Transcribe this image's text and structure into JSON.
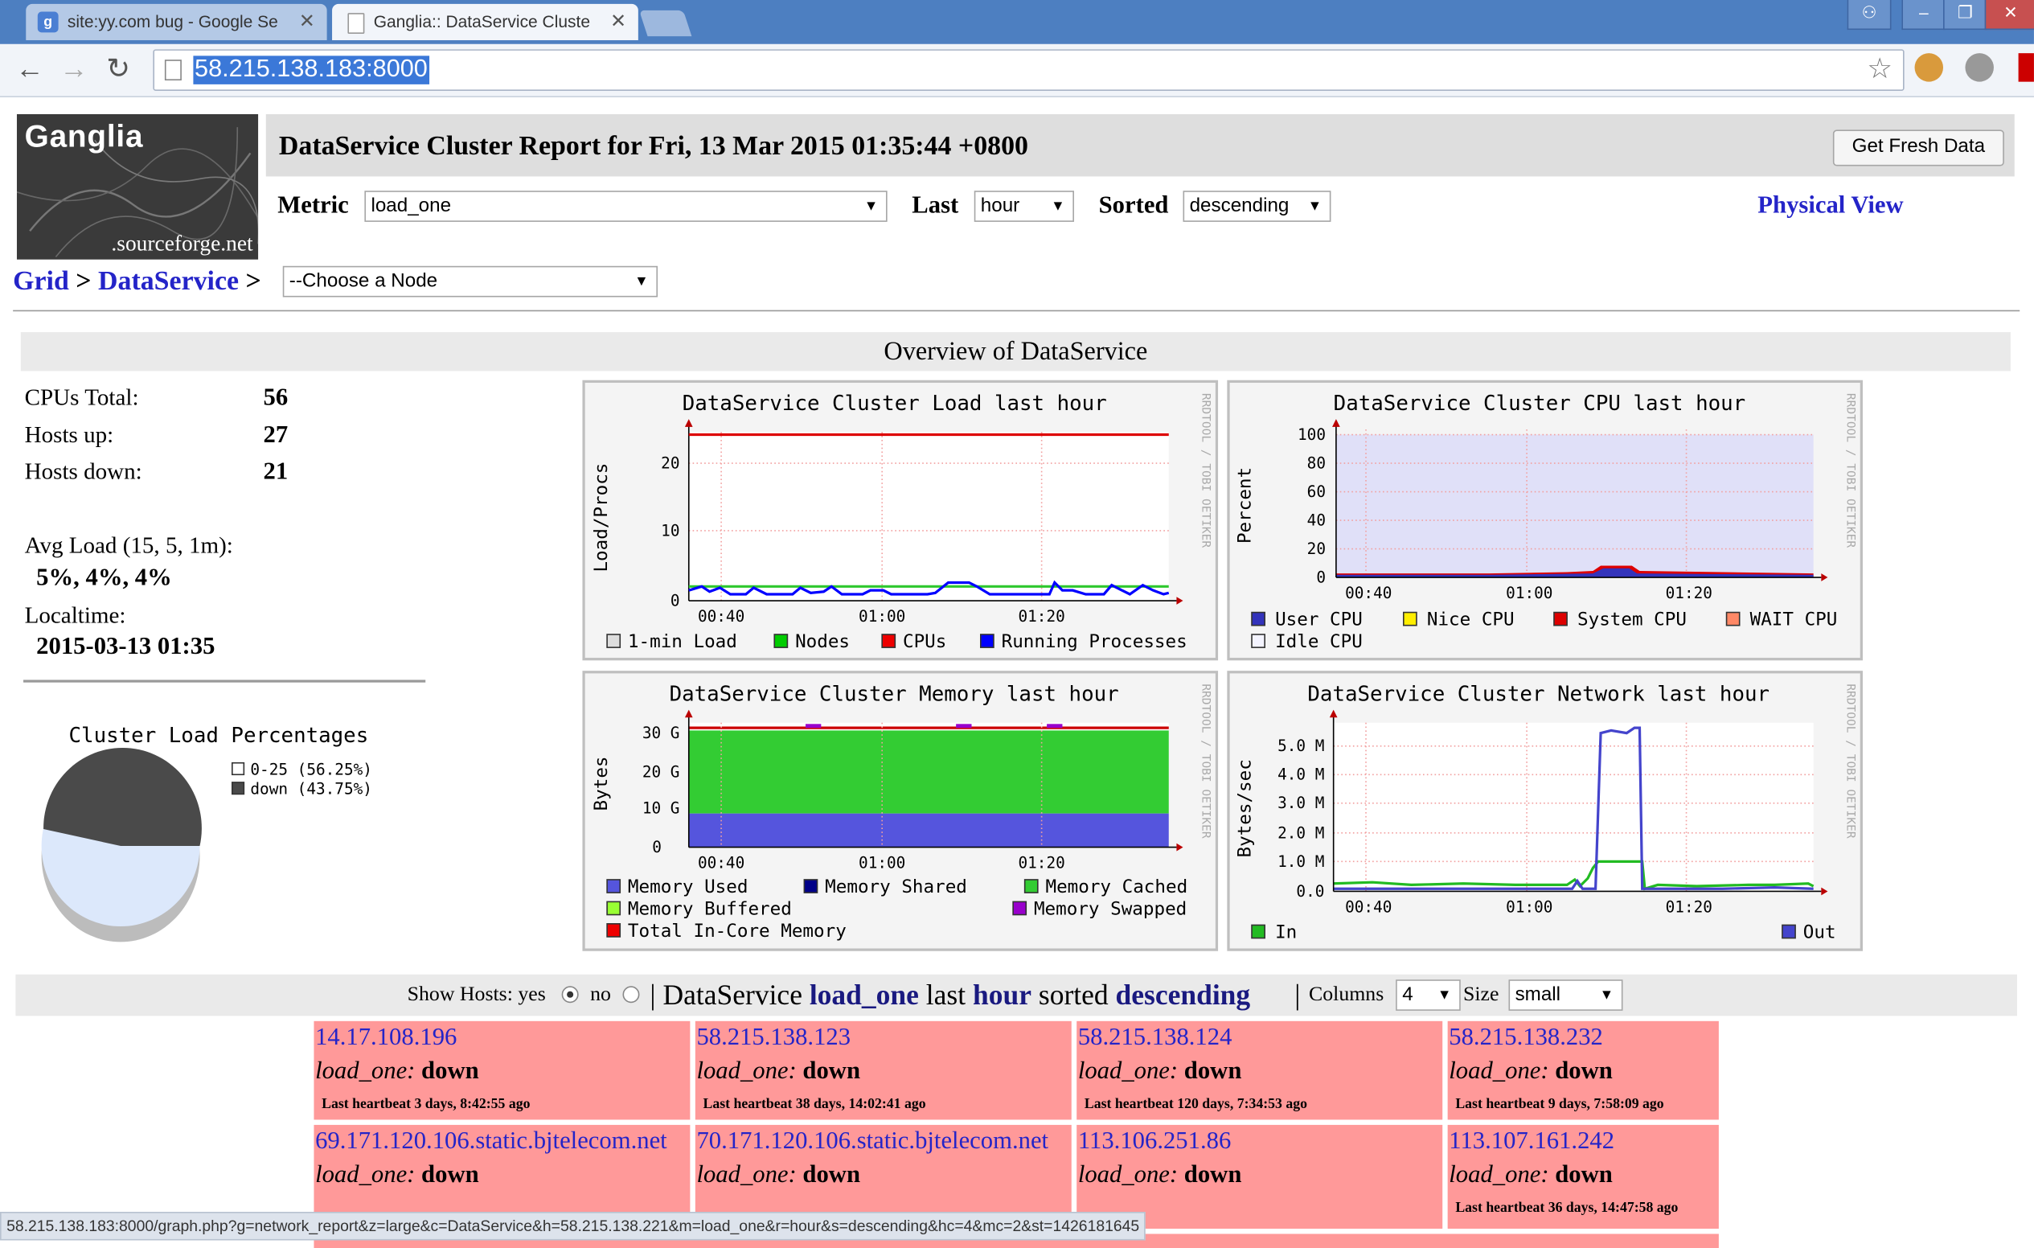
{
  "browser": {
    "tabs": [
      {
        "label": "site:yy.com bug - Google Se",
        "icon": "google-icon"
      },
      {
        "label": "Ganglia:: DataService Cluste",
        "icon": "page-icon"
      }
    ],
    "url": "58.215.138.183:8000",
    "status_url": "58.215.138.183:8000/graph.php?g=network_report&z=large&c=DataService&h=58.215.138.221&m=load_one&r=hour&s=descending&hc=4&mc=2&st=1426181645"
  },
  "header": {
    "logo_name": "Ganglia",
    "logo_sub": ".sourceforge.net",
    "title": "DataService Cluster Report for Fri, 13 Mar 2015 01:35:44 +0800",
    "fresh_button": "Get Fresh Data",
    "metric_label": "Metric",
    "metric_value": "load_one",
    "last_label": "Last",
    "last_value": "hour",
    "sorted_label": "Sorted",
    "sorted_value": "descending",
    "physical_view": "Physical View"
  },
  "breadcrumb": {
    "grid": "Grid",
    "sep1": ">",
    "cluster": "DataService",
    "sep2": ">",
    "node_select": "--Choose a Node"
  },
  "overview": {
    "title": "Overview of DataService",
    "cpus_label": "CPUs Total:",
    "cpus_value": "56",
    "hosts_up_label": "Hosts up:",
    "hosts_up_value": "27",
    "hosts_down_label": "Hosts down:",
    "hosts_down_value": "21",
    "avg_load_label": "Avg Load (15, 5, 1m):",
    "avg_load_value": "5%, 4%, 4%",
    "localtime_label": "Localtime:",
    "localtime_value": "2015-03-13 01:35",
    "pie_title": "Cluster Load Percentages",
    "pie_legend": [
      "0-25 (56.25%)",
      "down (43.75%)"
    ]
  },
  "graphs": {
    "load": {
      "title": "DataService Cluster Load last hour",
      "ylabel": "Load/Procs",
      "yticks": [
        "20",
        "10",
        "0"
      ],
      "xticks": [
        "00:40",
        "01:00",
        "01:20"
      ],
      "legend": [
        "1-min Load",
        "Nodes",
        "CPUs",
        "Running Processes"
      ]
    },
    "cpu": {
      "title": "DataService Cluster CPU last hour",
      "ylabel": "Percent",
      "yticks": [
        "100",
        "80",
        "60",
        "40",
        "20",
        "0"
      ],
      "xticks": [
        "00:40",
        "01:00",
        "01:20"
      ],
      "legend": [
        "User CPU",
        "Nice CPU",
        "System CPU",
        "WAIT CPU",
        "Idle CPU"
      ]
    },
    "memory": {
      "title": "DataService Cluster Memory last hour",
      "ylabel": "Bytes",
      "yticks": [
        "30 G",
        "20 G",
        "10 G",
        "0"
      ],
      "xticks": [
        "00:40",
        "01:00",
        "01:20"
      ],
      "legend": [
        "Memory Used",
        "Memory Shared",
        "Memory Cached",
        "Memory Buffered",
        "Memory Swapped",
        "Total In-Core Memory"
      ]
    },
    "network": {
      "title": "DataService Cluster Network last hour",
      "ylabel": "Bytes/sec",
      "yticks": [
        "5.0 M",
        "4.0 M",
        "3.0 M",
        "2.0 M",
        "1.0 M",
        "0.0"
      ],
      "xticks": [
        "00:40",
        "01:00",
        "01:20"
      ],
      "legend": [
        "In",
        "Out"
      ]
    },
    "rrdtool": "RRDTOOL / TOBI OETIKER"
  },
  "hosts_bar": {
    "show_hosts": "Show Hosts: yes",
    "no": "no",
    "pipe": "|",
    "cluster": "DataService",
    "metric": "load_one",
    "word_last": "last",
    "range": "hour",
    "word_sorted": "sorted",
    "sort": "descending",
    "columns_label": "Columns",
    "columns_value": "4",
    "size_label": "Size",
    "size_value": "small"
  },
  "hosts": [
    {
      "name": "14.17.108.196",
      "metric": "load_one:",
      "value": "down",
      "heartbeat": "Last heartbeat 3 days, 8:42:55 ago"
    },
    {
      "name": "58.215.138.123",
      "metric": "load_one:",
      "value": "down",
      "heartbeat": "Last heartbeat 38 days, 14:02:41 ago"
    },
    {
      "name": "58.215.138.124",
      "metric": "load_one:",
      "value": "down",
      "heartbeat": "Last heartbeat 120 days, 7:34:53 ago"
    },
    {
      "name": "58.215.138.232",
      "metric": "load_one:",
      "value": "down",
      "heartbeat": "Last heartbeat 9 days, 7:58:09 ago"
    },
    {
      "name": "69.171.120.106.static.bjtelecom.net",
      "metric": "load_one:",
      "value": "down",
      "heartbeat": ""
    },
    {
      "name": "70.171.120.106.static.bjtelecom.net",
      "metric": "load_one:",
      "value": "down",
      "heartbeat": ""
    },
    {
      "name": "113.106.251.86",
      "metric": "load_one:",
      "value": "down",
      "heartbeat": ""
    },
    {
      "name": "113.107.161.242",
      "metric": "load_one:",
      "value": "down",
      "heartbeat": "Last heartbeat 36 days, 14:47:58 ago"
    }
  ]
}
